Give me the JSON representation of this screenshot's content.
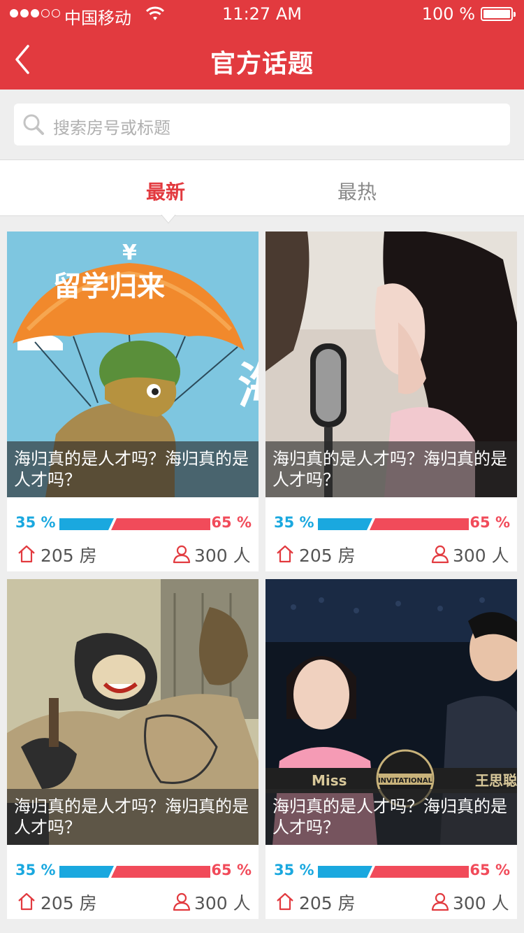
{
  "status_bar": {
    "carrier": "中国移动",
    "time": "11:27 AM",
    "battery": "100 %"
  },
  "nav": {
    "title": "官方话题"
  },
  "search": {
    "placeholder": "搜索房号或标题"
  },
  "tabs": [
    {
      "label": "最新",
      "active": true
    },
    {
      "label": "最热",
      "active": false
    }
  ],
  "colors": {
    "brand": "#e23a3f",
    "vote_left": "#1aa8df",
    "vote_right": "#f14b5a"
  },
  "topics": [
    {
      "title": "海归真的是人才吗？海归真的是人才吗？",
      "left_pct": "35 %",
      "right_pct": "65 %",
      "left_share": 0.35,
      "rooms": "205 房",
      "people": "300 人",
      "image": "paratrooper-turtle-cartoon"
    },
    {
      "title": "海归真的是人才吗？海归真的是人才吗？",
      "left_pct": "35 %",
      "right_pct": "65 %",
      "left_share": 0.35,
      "rooms": "205 房",
      "people": "300 人",
      "image": "girl-with-microphone-photo"
    },
    {
      "title": "海归真的是人才吗？海归真的是人才吗？",
      "left_pct": "35 %",
      "right_pct": "65 %",
      "left_share": 0.35,
      "rooms": "205 房",
      "people": "300 人",
      "image": "street-cartoon-illustration"
    },
    {
      "title": "海归真的是人才吗？海归真的是人才吗？",
      "left_pct": "35 %",
      "right_pct": "65 %",
      "left_share": 0.35,
      "rooms": "205 房",
      "people": "300 人",
      "image": "esports-casters-photo",
      "image_text": [
        "Miss",
        "INVITATIONAL",
        "王思聪"
      ]
    }
  ]
}
